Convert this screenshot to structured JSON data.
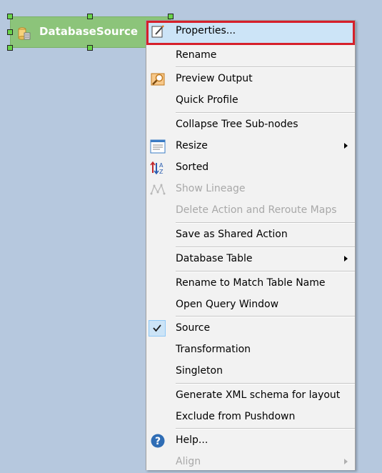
{
  "canvas": {
    "node": {
      "label": "DatabaseSource",
      "icon": "database-icon"
    }
  },
  "menu": {
    "items": [
      {
        "label": "Properties...",
        "icon": "pencil-note-icon"
      },
      {
        "label": "Rename"
      },
      {
        "label": "Preview Output",
        "icon": "magnifier-icon"
      },
      {
        "label": "Quick Profile"
      },
      {
        "label": "Collapse Tree Sub-nodes"
      },
      {
        "label": "Resize",
        "icon": "resize-list-icon",
        "submenu": true
      },
      {
        "label": "Sorted",
        "icon": "sort-az-icon"
      },
      {
        "label": "Show Lineage",
        "icon": "lineage-icon",
        "disabled": true
      },
      {
        "label": "Delete Action and Reroute Maps",
        "disabled": true
      },
      {
        "label": "Save as Shared Action"
      },
      {
        "label": "Database Table",
        "submenu": true
      },
      {
        "label": "Rename to Match Table Name"
      },
      {
        "label": "Open Query Window"
      },
      {
        "label": "Source",
        "checked": true,
        "icon": "checkmark-icon"
      },
      {
        "label": "Transformation"
      },
      {
        "label": "Singleton"
      },
      {
        "label": "Generate XML schema for layout"
      },
      {
        "label": "Exclude from Pushdown"
      },
      {
        "label": "Help...",
        "icon": "help-icon"
      },
      {
        "label": "Align",
        "disabled": true,
        "submenu": true
      }
    ]
  },
  "colors": {
    "canvas_background": "#b6c8de",
    "node_fill": "#8cc47a",
    "highlight_fill": "#cce4f7",
    "highlight_border": "#d6202b"
  }
}
